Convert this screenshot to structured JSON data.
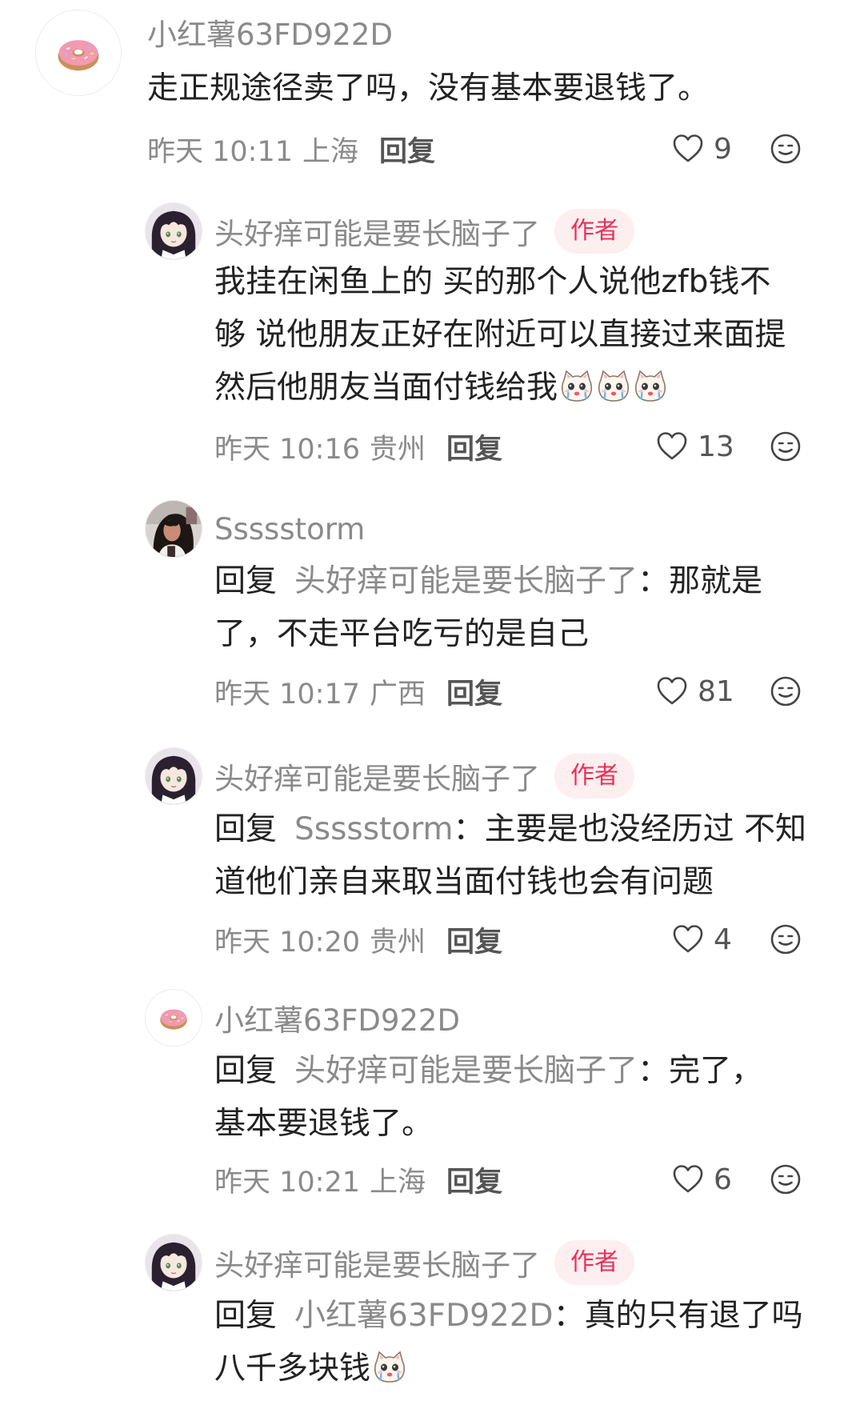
{
  "comments": [
    {
      "username": "小红薯63FD922D",
      "text": "走正规途径卖了吗，没有基本要退钱了。",
      "time": "昨天 10:11",
      "location": "上海",
      "reply_label": "回复",
      "likes": "9",
      "avatar_icon": "donut-avatar"
    }
  ],
  "replies": [
    {
      "username": "头好痒可能是要长脑子了",
      "badge": "作者",
      "text_lines": [
        "我挂在闲鱼上的 买的那个人说他zfb钱不",
        "够 说他朋友正好在附近可以直接过来面提",
        "然后他朋友当面付钱给我"
      ],
      "emoji_count": 3,
      "time": "昨天 10:16",
      "location": "贵州",
      "reply_label": "回复",
      "likes": "13"
    },
    {
      "username": "Ssssstorm",
      "reply_word": "回复",
      "reply_target": "头好痒可能是要长脑子了",
      "separator": "：",
      "text_line1": "那就是",
      "text_line2": "了，不走平台吃亏的是自己",
      "time": "昨天 10:17",
      "location": "广西",
      "reply_label": "回复",
      "likes": "81"
    },
    {
      "username": "头好痒可能是要长脑子了",
      "badge": "作者",
      "reply_word": "回复",
      "reply_target": "Ssssstorm",
      "separator": "：",
      "text_line1": "主要是也没经历过 不知",
      "text_line2": "道他们亲自来取当面付钱也会有问题",
      "time": "昨天 10:20",
      "location": "贵州",
      "reply_label": "回复",
      "likes": "4"
    },
    {
      "username": "小红薯63FD922D",
      "reply_word": "回复",
      "reply_target": "头好痒可能是要长脑子了",
      "separator": "：",
      "text_line1": "完了，",
      "text_line2": "基本要退钱了。",
      "time": "昨天 10:21",
      "location": "上海",
      "reply_label": "回复",
      "likes": "6"
    },
    {
      "username": "头好痒可能是要长脑子了",
      "badge": "作者",
      "reply_word": "回复",
      "reply_target": "小红薯63FD922D",
      "separator": "：",
      "text_line1": "真的只有退了吗",
      "text_line2": "八千多块钱",
      "emoji_count": 1
    }
  ],
  "colors": {
    "name_gray": "#8a8a8a",
    "text_dark": "#222222",
    "badge_bg": "#fdeef0",
    "badge_text": "#e8315a"
  },
  "icons": [
    "heart-outline-icon",
    "comment-emoji-icon",
    "crying-cat-emoji"
  ]
}
